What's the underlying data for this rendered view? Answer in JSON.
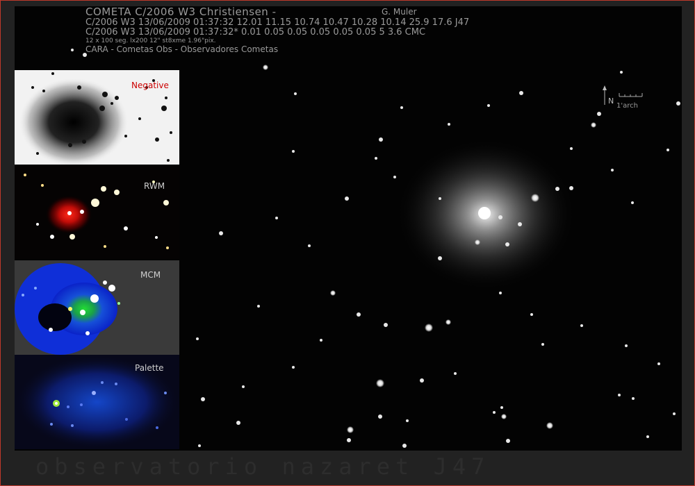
{
  "header": {
    "title": "COMETA C/2006 W3 Christiensen  -",
    "author": "G. Muler",
    "line1": "C/2006 W3 13/06/2009 01:37:32 12.01 11.15 10.74 10.47 10.28 10.14 25.9 17.6 J47",
    "line2": "C/2006 W3 13/06/2009 01:37:32* 0.01 0.05 0.05 0.05 0.05 0.05 5 3.6 CMC",
    "line3": "12 x 100 seg. lx200 12\" st8xme 1.96\"pix.",
    "line4": "CARA - Cometas Obs - Observadores Cometas"
  },
  "panels": {
    "negative": "Negative",
    "rwm": "RWM",
    "mcm": "MCM",
    "palette": "Palette"
  },
  "scale": {
    "north": "N",
    "label": "1'arch"
  },
  "footer": "observatorio nazaret J47",
  "colors": {
    "frame": "#c0392b",
    "negative_label": "#cc0000",
    "text": "#9a9a9a"
  }
}
